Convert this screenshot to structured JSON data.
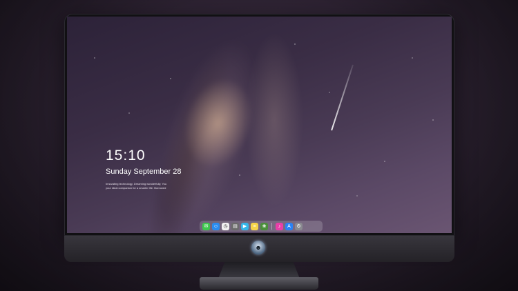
{
  "lockscreen": {
    "time": "15:10",
    "date": "Sunday September 28",
    "tagline_line1": "Innovating technology, Dreaming wonderfully, You",
    "tagline_line2": "your ideal companion for a smarter life. Borrowed"
  },
  "dock": {
    "icons": [
      {
        "name": "messages-icon",
        "glyph": "✉",
        "color": "#3ec74e"
      },
      {
        "name": "finder-icon",
        "glyph": "☺",
        "color": "#2a8cf0"
      },
      {
        "name": "clock-icon",
        "glyph": "◷",
        "color": "#f2f2f2"
      },
      {
        "name": "files-icon",
        "glyph": "▤",
        "color": "#6b6b6b"
      },
      {
        "name": "clapper-icon",
        "glyph": "▶",
        "color": "#34b6e8"
      },
      {
        "name": "notes-icon",
        "glyph": "≡",
        "color": "#f5d34a"
      },
      {
        "name": "photos-icon",
        "glyph": "❀",
        "color": "#4a8f3a"
      },
      {
        "name": "music-icon",
        "glyph": "♪",
        "color": "#e83fa8"
      },
      {
        "name": "store-icon",
        "glyph": "A",
        "color": "#2a82f5"
      },
      {
        "name": "settings-icon",
        "glyph": "⚙",
        "color": "#8a8a90"
      }
    ]
  }
}
